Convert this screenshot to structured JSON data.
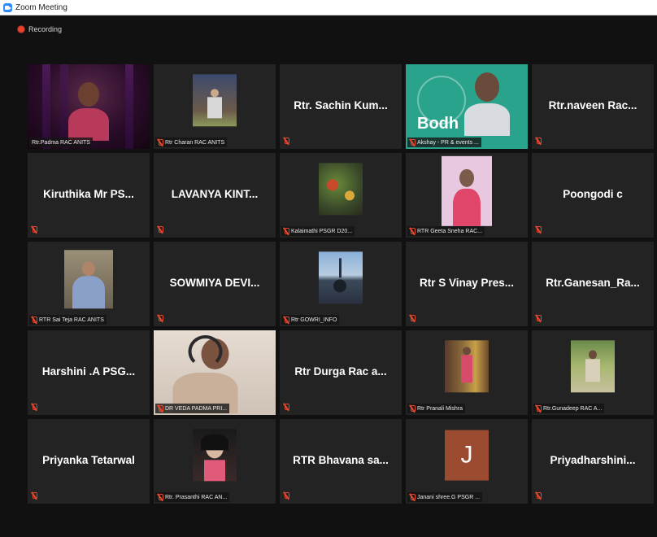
{
  "window": {
    "title": "Zoom Meeting"
  },
  "recording": {
    "label": "Recording"
  },
  "colors": {
    "active_speaker_border": "#e9e96a",
    "mic_muted": "#e5482f",
    "avatar_j": "#9b4b2f"
  },
  "participants": [
    {
      "name": "Rtr.Padma RAC ANITS",
      "display": "video",
      "active": true
    },
    {
      "name": "Rtr Charan RAC ANITS",
      "display": "photo"
    },
    {
      "name": "Rtr. Sachin Kum...",
      "display": "name"
    },
    {
      "name": "Akshay - PR & events ...",
      "display": "video",
      "overlay_text": "Bodh"
    },
    {
      "name": "Rtr.naveen Rac...",
      "display": "name"
    },
    {
      "name": "Kiruthika Mr PS...",
      "display": "name"
    },
    {
      "name": "LAVANYA KINT...",
      "display": "name"
    },
    {
      "name": "Kalaimathi PSGR D20...",
      "display": "photo"
    },
    {
      "name": "RTR Geeta Sneha RAC...",
      "display": "photo"
    },
    {
      "name": "Poongodi c",
      "display": "name"
    },
    {
      "name": "RTR Sai Teja RAC ANITS",
      "display": "photo"
    },
    {
      "name": "SOWMIYA DEVI...",
      "display": "name"
    },
    {
      "name": "Rtr GOWRI_INFO",
      "display": "photo"
    },
    {
      "name": "Rtr S Vinay Pres...",
      "display": "name"
    },
    {
      "name": "Rtr.Ganesan_Ra...",
      "display": "name"
    },
    {
      "name": "Harshini .A PSG...",
      "display": "name"
    },
    {
      "name": "DR VEDA PADMA PRI...",
      "display": "video"
    },
    {
      "name": "Rtr Durga Rac a...",
      "display": "name"
    },
    {
      "name": "Rtr Pranali Mishra",
      "display": "photo"
    },
    {
      "name": "Rtr.Gunadeep RAC A...",
      "display": "photo"
    },
    {
      "name": "Priyanka Tetarwal",
      "display": "name"
    },
    {
      "name": "Rtr. Prasanthi RAC AN...",
      "display": "photo"
    },
    {
      "name": "RTR Bhavana sa...",
      "display": "name"
    },
    {
      "name": "Janani shree.G PSGR ...",
      "display": "avatar",
      "initial": "J"
    },
    {
      "name": "Priyadharshini...",
      "display": "name"
    }
  ]
}
